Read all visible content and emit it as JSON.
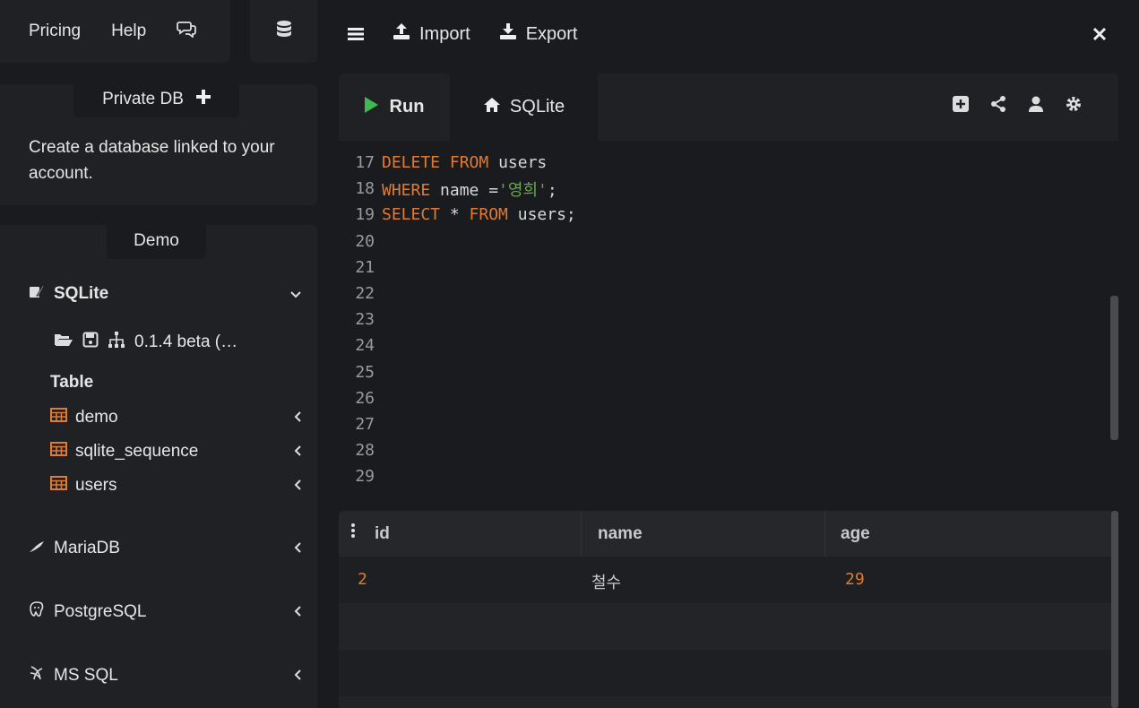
{
  "header": {
    "links": [
      "Pricing",
      "Help"
    ],
    "chat_icon": "chat-icon",
    "database_icon": "database-icon"
  },
  "private_db": {
    "tab_label": "Private DB",
    "add_icon": "plus-icon",
    "description": "Create a database linked to your account."
  },
  "demo": {
    "tab_label": "Demo",
    "sqlite": {
      "label": "SQLite",
      "version": "0.1.4 beta (…",
      "table_heading": "Table",
      "tables": [
        "demo",
        "sqlite_sequence",
        "users"
      ]
    },
    "other_dbs": [
      "MariaDB",
      "PostgreSQL",
      "MS SQL"
    ]
  },
  "toolbar": {
    "menu_icon": "hamburger-icon",
    "import_label": "Import",
    "export_label": "Export",
    "close_icon": "close-icon"
  },
  "editor": {
    "run_label": "Run",
    "tab_label": "SQLite",
    "head_icons": [
      "plus-square-icon",
      "share-icon",
      "user-icon",
      "gear-icon"
    ],
    "lines": [
      {
        "n": "17",
        "tokens": [
          [
            "kw",
            "DELETE"
          ],
          [
            "id",
            " "
          ],
          [
            "kw",
            "FROM"
          ],
          [
            "id",
            " users"
          ]
        ]
      },
      {
        "n": "18",
        "tokens": [
          [
            "kw",
            "WHERE"
          ],
          [
            "id",
            " name ="
          ],
          [
            "str",
            "'영희'"
          ],
          [
            "id",
            ";"
          ]
        ]
      },
      {
        "n": "19",
        "tokens": [
          [
            "kw",
            "SELECT"
          ],
          [
            "id",
            " * "
          ],
          [
            "kw",
            "FROM"
          ],
          [
            "id",
            " users;"
          ]
        ]
      },
      {
        "n": "20",
        "tokens": []
      },
      {
        "n": "21",
        "tokens": []
      },
      {
        "n": "22",
        "tokens": []
      },
      {
        "n": "23",
        "tokens": []
      },
      {
        "n": "24",
        "tokens": []
      },
      {
        "n": "25",
        "tokens": []
      },
      {
        "n": "26",
        "tokens": []
      },
      {
        "n": "27",
        "tokens": []
      },
      {
        "n": "28",
        "tokens": []
      },
      {
        "n": "29",
        "tokens": []
      }
    ]
  },
  "results": {
    "columns": [
      "id",
      "name",
      "age"
    ],
    "rows": [
      [
        "2",
        "철수",
        "29"
      ]
    ]
  },
  "colors": {
    "keyword": "#e07b33",
    "string": "#6aa84f",
    "run_green": "#3fb950",
    "table_icon": "#e07b33"
  }
}
